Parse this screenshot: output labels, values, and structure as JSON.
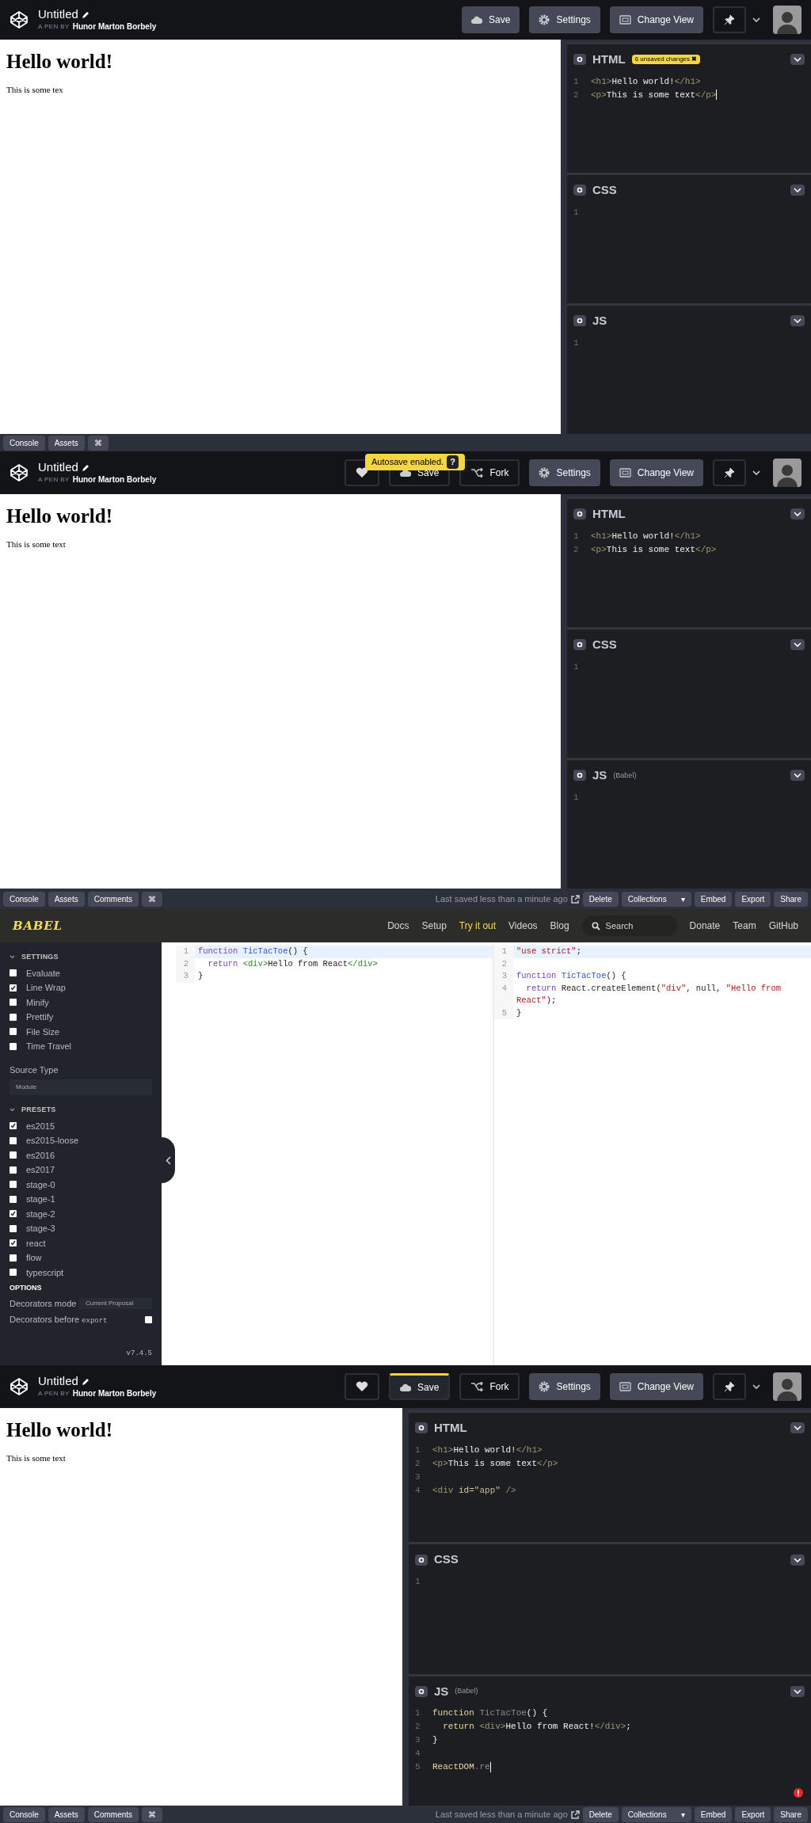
{
  "screens": [
    {
      "kind": "codepen",
      "title": "Untitled",
      "byline": "A PEN BY",
      "author": "Hunor Marton Borbely",
      "buttons": [
        {
          "kind": "save",
          "label": "Save",
          "active": false
        },
        {
          "kind": "settings",
          "label": "Settings",
          "active": false
        },
        {
          "kind": "view",
          "label": "Change View",
          "active": false
        },
        {
          "kind": "pin",
          "active": false
        }
      ],
      "preview": {
        "heading": "Hello world!",
        "paragraph": "This is some tex"
      },
      "editors": [
        {
          "name": "HTML",
          "badge": "6 unsaved changes",
          "badge_close": "✖",
          "cursor": true,
          "lines": [
            {
              "n": "1",
              "code": [
                {
                  "kind": "tag",
                  "t": "<h1>"
                },
                {
                  "kind": "text",
                  "t": "Hello world!"
                },
                {
                  "kind": "tag",
                  "t": "</h1>"
                }
              ]
            },
            {
              "n": "2",
              "code": [
                {
                  "kind": "tag",
                  "t": "<p>"
                },
                {
                  "kind": "text",
                  "t": "This is some text"
                },
                {
                  "kind": "tag",
                  "t": "</p>"
                }
              ]
            }
          ]
        },
        {
          "name": "CSS",
          "lines": [
            {
              "n": "1"
            }
          ]
        },
        {
          "name": "JS",
          "lines": [
            {
              "n": "1"
            }
          ]
        }
      ],
      "footer": {
        "left": [
          "Console",
          "Assets",
          "⌘"
        ]
      }
    },
    {
      "kind": "codepen",
      "title": "Untitled",
      "byline": "A PEN BY",
      "author": "Hunor Marton Borbely",
      "toast": "Autosave enabled.",
      "toast_help": "?",
      "buttons": [
        {
          "kind": "heart",
          "active": false
        },
        {
          "kind": "save",
          "label": "Save",
          "active": false
        },
        {
          "kind": "fork",
          "label": "Fork",
          "active": false
        },
        {
          "kind": "settings",
          "label": "Settings",
          "active": false
        },
        {
          "kind": "view",
          "label": "Change View",
          "active": false
        },
        {
          "kind": "pin",
          "active": false
        }
      ],
      "preview": {
        "heading": "Hello world!",
        "paragraph": "This is some text"
      },
      "editors": [
        {
          "name": "HTML",
          "lines": [
            {
              "n": "1",
              "code": [
                {
                  "kind": "tag",
                  "t": "<h1>"
                },
                {
                  "kind": "text",
                  "t": "Hello world!"
                },
                {
                  "kind": "tag",
                  "t": "</h1>"
                }
              ]
            },
            {
              "n": "2",
              "code": [
                {
                  "kind": "tag",
                  "t": "<p>"
                },
                {
                  "kind": "text",
                  "t": "This is some text"
                },
                {
                  "kind": "tag",
                  "t": "</p>"
                }
              ]
            }
          ]
        },
        {
          "name": "CSS",
          "lines": [
            {
              "n": "1"
            }
          ]
        },
        {
          "name": "JS",
          "sub": "(Babel)",
          "lines": [
            {
              "n": "1"
            }
          ]
        }
      ],
      "footer": {
        "left": [
          "Console",
          "Assets",
          "Comments",
          "⌘"
        ],
        "status": "Last saved less than a minute ago",
        "right": [
          {
            "label": "Delete",
            "kind": "plain"
          },
          {
            "label": "Collections",
            "kind": "dropdown",
            "caret": "▾"
          },
          {
            "label": "Embed",
            "kind": "plain"
          },
          {
            "label": "Export",
            "kind": "plain"
          },
          {
            "label": "Share",
            "kind": "plain"
          }
        ]
      }
    },
    {
      "kind": "babel",
      "logo": "BABEL",
      "nav": [
        {
          "label": "Docs",
          "selected": false
        },
        {
          "label": "Setup",
          "selected": false
        },
        {
          "label": "Try it out",
          "selected": true
        },
        {
          "label": "Videos",
          "selected": false
        },
        {
          "label": "Blog",
          "selected": false
        }
      ],
      "search": {
        "placeholder": "Search"
      },
      "nav_right": [
        "Donate",
        "Team",
        "GitHub"
      ],
      "settings": {
        "title": "SETTINGS",
        "options": [
          {
            "label": "Evaluate",
            "checked": false
          },
          {
            "label": "Line Wrap",
            "checked": true
          },
          {
            "label": "Minify",
            "checked": false
          },
          {
            "label": "Prettify",
            "checked": false
          },
          {
            "label": "File Size",
            "checked": false
          },
          {
            "label": "Time Travel",
            "checked": false
          }
        ]
      },
      "source_type": {
        "label": "Source Type",
        "value": "Module"
      },
      "presets": {
        "title": "PRESETS",
        "options": [
          {
            "label": "es2015",
            "checked": true
          },
          {
            "label": "es2015-loose",
            "checked": false
          },
          {
            "label": "es2016",
            "checked": false
          },
          {
            "label": "es2017",
            "checked": false
          },
          {
            "label": "stage-0",
            "checked": false
          },
          {
            "label": "stage-1",
            "checked": false
          },
          {
            "label": "stage-2",
            "checked": true
          },
          {
            "label": "stage-3",
            "checked": false
          },
          {
            "label": "react",
            "checked": true
          },
          {
            "label": "flow",
            "checked": false
          },
          {
            "label": "typescript",
            "checked": false
          }
        ]
      },
      "options": {
        "title": "OPTIONS",
        "decorators_mode": {
          "label": "Decorators mode",
          "value": "Current Proposal"
        },
        "decorators_before": {
          "label": "Decorators before",
          "code": "export",
          "checked": false
        }
      },
      "version": "v7.4.5",
      "input": [
        {
          "n": "1",
          "highlighted": true,
          "code": [
            {
              "kind": "kw",
              "t": "function "
            },
            {
              "kind": "def",
              "t": "TicTacToe"
            },
            {
              "kind": "plain",
              "t": "() {"
            }
          ]
        },
        {
          "n": "2",
          "highlighted": false,
          "code": [
            {
              "kind": "kw",
              "t": "  return "
            },
            {
              "kind": "tag",
              "t": "<div>"
            },
            {
              "kind": "plain",
              "t": "Hello from React"
            },
            {
              "kind": "tag",
              "t": "</div>"
            }
          ]
        },
        {
          "n": "3",
          "highlighted": false,
          "code": [
            {
              "kind": "plain",
              "t": "}"
            }
          ]
        }
      ],
      "output": [
        {
          "n": "1",
          "highlighted": true,
          "code": [
            {
              "kind": "string",
              "t": "\"use strict\""
            },
            {
              "kind": "plain",
              "t": ";"
            }
          ]
        },
        {
          "n": "2",
          "highlighted": false
        },
        {
          "n": "3",
          "highlighted": false,
          "code": [
            {
              "kind": "kw",
              "t": "function "
            },
            {
              "kind": "def",
              "t": "TicTacToe"
            },
            {
              "kind": "plain",
              "t": "() {"
            }
          ]
        },
        {
          "n": "4",
          "highlighted": false,
          "code": [
            {
              "kind": "kw",
              "t": "  return "
            },
            {
              "kind": "plain",
              "t": "React.createElement("
            },
            {
              "kind": "string",
              "t": "\"div\""
            },
            {
              "kind": "plain",
              "t": ", null, "
            },
            {
              "kind": "string",
              "t": "\"Hello from React\""
            },
            {
              "kind": "plain",
              "t": ");"
            }
          ]
        },
        {
          "n": "5",
          "highlighted": false,
          "code": [
            {
              "kind": "plain",
              "t": "}"
            }
          ]
        }
      ]
    },
    {
      "kind": "codepen",
      "title": "Untitled",
      "byline": "A PEN BY",
      "author": "Hunor Marton Borbely",
      "buttons": [
        {
          "kind": "heart",
          "active": false
        },
        {
          "kind": "save",
          "label": "Save",
          "active": true
        },
        {
          "kind": "fork",
          "label": "Fork",
          "active": false
        },
        {
          "kind": "settings",
          "label": "Settings",
          "active": false
        },
        {
          "kind": "view",
          "label": "Change View",
          "active": false
        },
        {
          "kind": "pin",
          "active": false
        }
      ],
      "preview": {
        "heading": "Hello world!",
        "paragraph": "This is some text"
      },
      "editors": [
        {
          "name": "HTML",
          "lines": [
            {
              "n": "1",
              "code": [
                {
                  "kind": "tag",
                  "t": "<h1>"
                },
                {
                  "kind": "text",
                  "t": "Hello world!"
                },
                {
                  "kind": "tag",
                  "t": "</h1>"
                }
              ]
            },
            {
              "n": "2",
              "code": [
                {
                  "kind": "tag",
                  "t": "<p>"
                },
                {
                  "kind": "text",
                  "t": "This is some text"
                },
                {
                  "kind": "tag",
                  "t": "</p>"
                }
              ]
            },
            {
              "n": "3"
            },
            {
              "n": "4",
              "code": [
                {
                  "kind": "tag",
                  "t": "<div "
                },
                {
                  "kind": "attr",
                  "t": "id="
                },
                {
                  "kind": "string",
                  "t": "\"app\""
                },
                {
                  "kind": "tag",
                  "t": " />"
                }
              ]
            }
          ]
        },
        {
          "name": "CSS",
          "lines": [
            {
              "n": "1"
            }
          ]
        },
        {
          "name": "JS",
          "sub": "(Babel)",
          "cursor": true,
          "error": true,
          "lines": [
            {
              "n": "1",
              "code": [
                {
                  "kind": "kw",
                  "t": "function "
                },
                {
                  "kind": "name",
                  "t": "TicTacToe"
                },
                {
                  "kind": "text",
                  "t": "() {"
                }
              ]
            },
            {
              "n": "2",
              "code": [
                {
                  "kind": "kw",
                  "t": "  return "
                },
                {
                  "kind": "tag",
                  "t": "<div>"
                },
                {
                  "kind": "text",
                  "t": "Hello from React!"
                },
                {
                  "kind": "tag",
                  "t": "</div>"
                },
                {
                  "kind": "text",
                  "t": ";"
                }
              ]
            },
            {
              "n": "3",
              "code": [
                {
                  "kind": "text",
                  "t": "}"
                }
              ]
            },
            {
              "n": "4"
            },
            {
              "n": "5",
              "code": [
                {
                  "kind": "kw",
                  "t": "ReactDOM"
                },
                {
                  "kind": "name",
                  "t": ".re"
                }
              ]
            }
          ]
        }
      ],
      "footer": {
        "left": [
          "Console",
          "Assets",
          "Comments",
          "⌘"
        ],
        "status": "Last saved less than a minute ago",
        "right": [
          {
            "label": "Delete",
            "kind": "plain"
          },
          {
            "label": "Collections",
            "kind": "dropdown",
            "caret": "▾"
          },
          {
            "label": "Embed",
            "kind": "plain"
          },
          {
            "label": "Export",
            "kind": "plain"
          },
          {
            "label": "Share",
            "kind": "plain"
          }
        ]
      }
    }
  ]
}
